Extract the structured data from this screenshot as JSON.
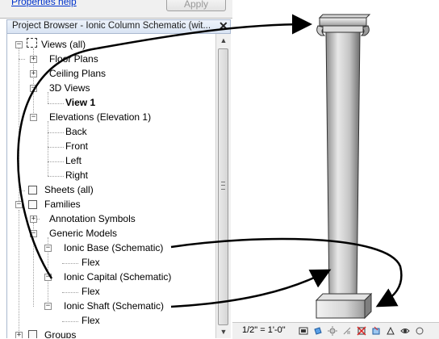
{
  "top_strip": {
    "properties_help": "Properties help",
    "apply_label": "Apply"
  },
  "project_browser": {
    "title": "Project Browser - Ionic Column Schematic (wit...",
    "close_glyph": "✕",
    "tree": {
      "views_all": "Views (all)",
      "floor_plans": "Floor Plans",
      "ceiling_plans": "Ceiling Plans",
      "views_3d": "3D Views",
      "view_1": "View 1",
      "elevations": "Elevations (Elevation 1)",
      "back": "Back",
      "front": "Front",
      "left": "Left",
      "right": "Right",
      "sheets_all": "Sheets (all)",
      "families": "Families",
      "annotation_symbols": "Annotation Symbols",
      "generic_models": "Generic Models",
      "ionic_base": "Ionic Base (Schematic)",
      "flex_base": "Flex",
      "ionic_capital": "Ionic Capital (Schematic)",
      "flex_capital": "Flex",
      "ionic_shaft": "Ionic Shaft (Schematic)",
      "flex_shaft": "Flex",
      "groups": "Groups"
    }
  },
  "view_control_bar": {
    "scale": "1/2\" = 1'-0\"",
    "icons": [
      "detail-level-icon",
      "visual-style-icon",
      "sun-path-icon",
      "shadows-icon",
      "crop-view-icon",
      "show-crop-icon",
      "temporary-hide-icon",
      "reveal-hidden-icon",
      "analysis-icon"
    ]
  },
  "colors": {
    "arrow": "#000000",
    "column_light": "#e6e6e6",
    "column_dark": "#7a7a7a",
    "titlebar": "#dbe5f3"
  }
}
